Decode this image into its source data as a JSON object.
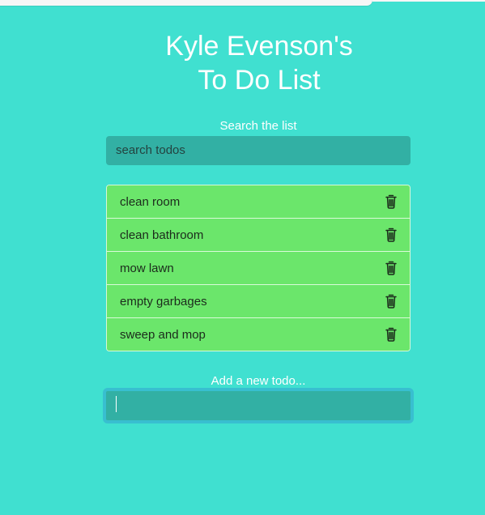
{
  "header": {
    "title_line1": "Kyle Evenson's",
    "title_line2": "To Do List"
  },
  "search": {
    "label": "Search the list",
    "placeholder": "search todos"
  },
  "todos": [
    {
      "label": "clean room",
      "icon": "trash-icon"
    },
    {
      "label": "clean bathroom",
      "icon": "trash-icon"
    },
    {
      "label": "mow lawn",
      "icon": "trash-icon"
    },
    {
      "label": "empty garbages",
      "icon": "trash-icon"
    },
    {
      "label": "sweep and mop",
      "icon": "trash-icon"
    }
  ],
  "add_todo": {
    "label": "Add a new todo...",
    "value": ""
  },
  "colors": {
    "background": "#40e0d0",
    "input_bg": "#32b0a4",
    "todo_bg": "#6be66b",
    "focus_border": "#38bfd0",
    "text_light": "#ffffff"
  }
}
